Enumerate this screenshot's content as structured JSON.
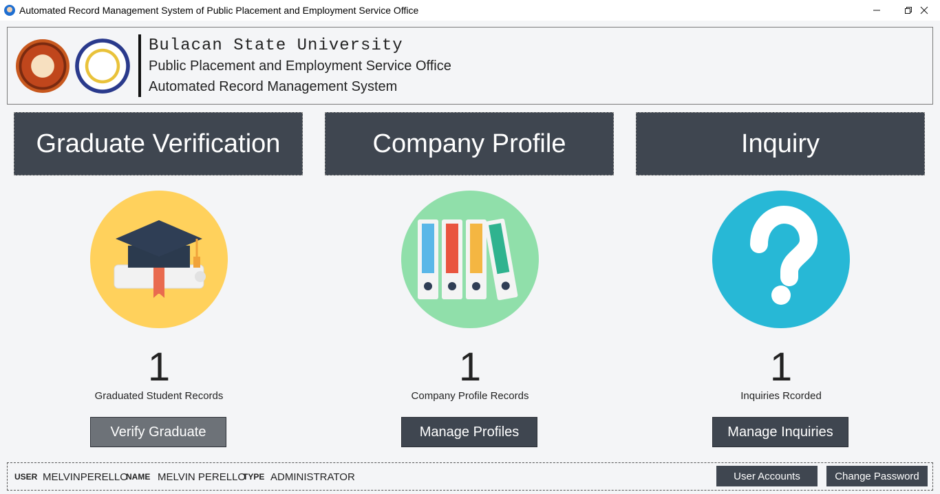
{
  "window": {
    "title": "Automated Record Management System of Public Placement and Employment Service Office",
    "controls": [
      "minimize",
      "restore",
      "close"
    ]
  },
  "header": {
    "logos": [
      "bulsu-logo",
      "peso-logo"
    ],
    "university": "Bulacan State University",
    "office": "Public Placement and Employment Service Office",
    "system": "Automated Record Management System"
  },
  "modules": [
    {
      "title": "Graduate Verification",
      "icon": "graduation-cap-icon",
      "icon_bg": "#FFD15C",
      "count": "1",
      "caption": "Graduated Student Records",
      "button": "Verify Graduate"
    },
    {
      "title": "Company Profile",
      "icon": "binders-icon",
      "icon_bg": "#90DFAA",
      "count": "1",
      "caption": "Company Profile Records",
      "button": "Manage Profiles"
    },
    {
      "title": "Inquiry",
      "icon": "question-mark-icon",
      "icon_bg": "#27B8D6",
      "count": "1",
      "caption": "Inquiries Rcorded",
      "button": "Manage Inquiries"
    }
  ],
  "footer": {
    "user_label": "USER",
    "user_value": "MELVINPERELLO",
    "name_label": "NAME",
    "name_value": "MELVIN PERELLO",
    "type_label": "TYPE",
    "type_value": "ADMINISTRATOR",
    "user_accounts_btn": "User Accounts",
    "change_password_btn": "Change Password"
  },
  "colors": {
    "dark_panel": "#3F4650",
    "active_button": "#6D7278",
    "background": "#F4F5F7"
  }
}
